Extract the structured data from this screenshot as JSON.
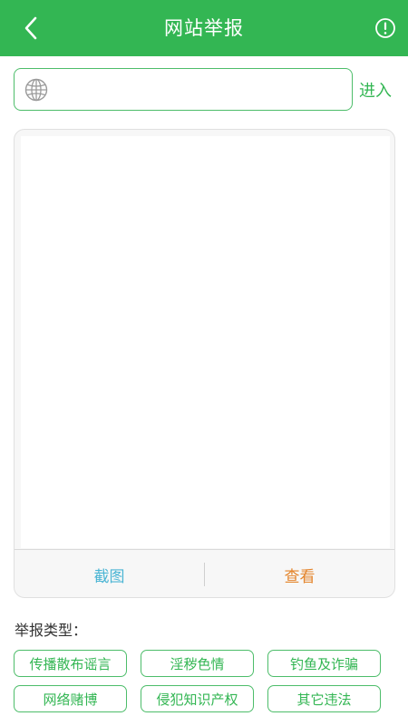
{
  "header": {
    "title": "网站举报",
    "back_icon": "chevron-left-icon",
    "info_icon": "exclamation-circle-icon"
  },
  "url_bar": {
    "value": "",
    "placeholder": "",
    "icon": "globe-icon",
    "enter_label": "进入"
  },
  "preview": {
    "screenshot_label": "截图",
    "view_label": "查看"
  },
  "report_types": {
    "label": "举报类型：",
    "tags": [
      "传播散布谣言",
      "淫秽色情",
      "钓鱼及诈骗",
      "网络赌博",
      "侵犯知识产权",
      "其它违法"
    ]
  },
  "colors": {
    "brand_green": "#33b653",
    "screenshot_blue": "#4bb5d4",
    "view_orange": "#e4842b"
  }
}
